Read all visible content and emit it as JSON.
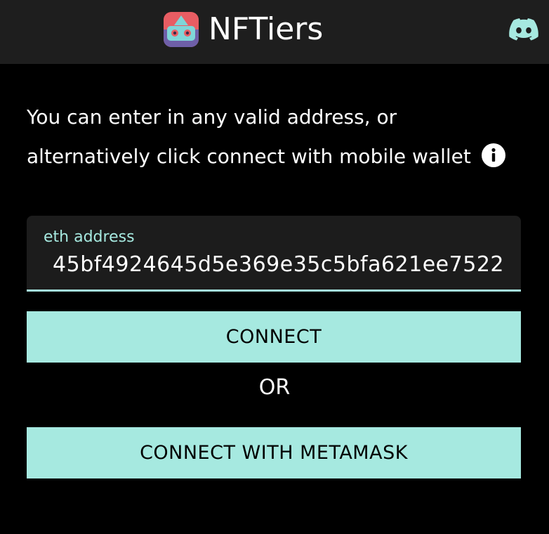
{
  "header": {
    "brand_name": "NFTiers",
    "logo_icon": "robot-logo-icon",
    "discord_icon": "discord-icon"
  },
  "intro": {
    "text": "You can enter in any valid address, or alternatively click connect with mobile wallet",
    "info_icon": "info-icon"
  },
  "address_field": {
    "label": "eth address",
    "value": "45bf4924645d5e369e35c5bfa621ee7522"
  },
  "buttons": {
    "connect_label": "CONNECT",
    "separator_label": "OR",
    "metamask_label": "CONNECT WITH METAMASK"
  },
  "colors": {
    "accent": "#a6e9e0",
    "header_bg": "#1e1e1e",
    "page_bg": "#000000",
    "field_bg": "#1c1c1c"
  }
}
